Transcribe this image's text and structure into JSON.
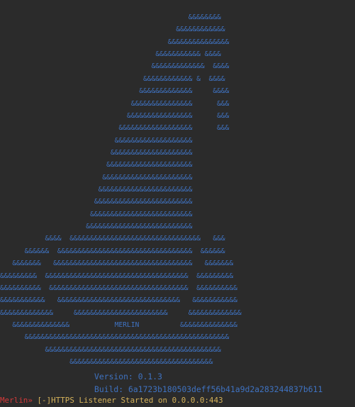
{
  "colors": {
    "background": "#2b2b2b",
    "banner": "#3f72c0",
    "prompt": "#d13a3a",
    "status": "#d4b15a"
  },
  "banner_lines": [
    "                                              &&&&&&&&",
    "                                           &&&&&&&&&&&&",
    "                                         &&&&&&&&&&&&&&&",
    "                                      &&&&&&&&&&& &&&&",
    "                                     &&&&&&&&&&&&&  &&&&",
    "                                   &&&&&&&&&&&& &  &&&&",
    "                                  &&&&&&&&&&&&&     &&&&",
    "                                &&&&&&&&&&&&&&&      &&&",
    "                               &&&&&&&&&&&&&&&&      &&&",
    "                             &&&&&&&&&&&&&&&&&&      &&&",
    "                            &&&&&&&&&&&&&&&&&&&",
    "                           &&&&&&&&&&&&&&&&&&&&",
    "                          &&&&&&&&&&&&&&&&&&&&&",
    "                         &&&&&&&&&&&&&&&&&&&&&&",
    "                        &&&&&&&&&&&&&&&&&&&&&&&",
    "                       &&&&&&&&&&&&&&&&&&&&&&&&",
    "                      &&&&&&&&&&&&&&&&&&&&&&&&&",
    "                     &&&&&&&&&&&&&&&&&&&&&&&&&&",
    "           &&&&  &&&&&&&&&&&&&&&&&&&&&&&&&&&&&&&&   &&&",
    "      &&&&&&  &&&&&&&&&&&&&&&&&&&&&&&&&&&&&&&&&  &&&&&&",
    "   &&&&&&&   &&&&&&&&&&&&&&&&&&&&&&&&&&&&&&&&&&   &&&&&&&",
    "&&&&&&&&&  &&&&&&&&&&&&&&&&&&&&&&&&&&&&&&&&&&&  &&&&&&&&&",
    "&&&&&&&&&&  &&&&&&&&&&&&&&&&&&&&&&&&&&&&&&&&&&  &&&&&&&&&&",
    "&&&&&&&&&&&   &&&&&&&&&&&&&&&&&&&&&&&&&&&&&&   &&&&&&&&&&&",
    "&&&&&&&&&&&&&     &&&&&&&&&&&&&&&&&&&&&&&     &&&&&&&&&&&&&",
    "   &&&&&&&&&&&&&&           MERLIN          &&&&&&&&&&&&&&",
    "      &&&&&&&&&&&&&&&&&&&&&&&&&&&&&&&&&&&&&&&&&&&&&&&&&&",
    "           &&&&&&&&&&&&&&&&&&&&&&&&&&&&&&&&&&&&&&&&&&&",
    "                 &&&&&&&&&&&&&&&&&&&&&&&&&&&&&&&&&&&"
  ],
  "version_line": "Version: 0.1.3",
  "build_line": "Build: 6a1723b180503deff56b41a9d2a283244837b611",
  "prompt": {
    "label": "Merlin",
    "arrow": "»",
    "message": " [-]HTTPS Listener Started on 0.0.0.0:443"
  }
}
